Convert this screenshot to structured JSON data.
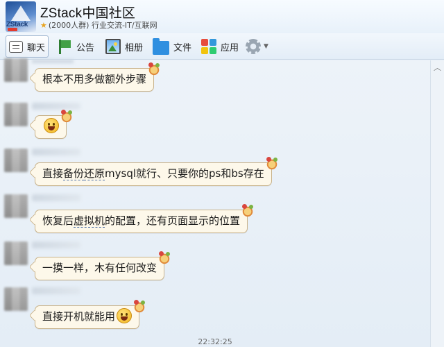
{
  "header": {
    "title": "ZStack中国社区",
    "subtitle": "(2000人群) 行业交流-IT/互联网",
    "logo_text": "ZStack",
    "star_icon": "star-icon"
  },
  "toolbar": {
    "items": [
      {
        "label": "聊天",
        "icon": "chat-icon",
        "active": true
      },
      {
        "label": "公告",
        "icon": "notice-flag-icon"
      },
      {
        "label": "相册",
        "icon": "album-icon"
      },
      {
        "label": "文件",
        "icon": "folder-icon"
      },
      {
        "label": "应用",
        "icon": "apps-icon"
      }
    ],
    "settings_icon": "gear-icon",
    "app_colors": [
      "#e74c3c",
      "#3498db",
      "#f1c40f",
      "#2ecc71"
    ]
  },
  "messages": [
    {
      "text": "根本不用多做额外步骤"
    },
    {
      "text": "",
      "emoji": "grin-emoji"
    },
    {
      "text_parts": [
        "直接",
        "备份",
        "还原",
        "mysql就行、只要你的ps和bs存在"
      ]
    },
    {
      "text_parts": [
        "恢复后",
        "虚拟机",
        "的配置，还有页面显示的位置"
      ]
    },
    {
      "text": "一摸一样，木有任何改变"
    },
    {
      "text": "直接开机就能用",
      "emoji": "grin-emoji"
    }
  ],
  "timestamp": "22:32:25",
  "colors": {
    "bubble_bg": "#fdf8ea",
    "bubble_border": "#c8b28a",
    "chat_bg": "#e9f1f9"
  }
}
